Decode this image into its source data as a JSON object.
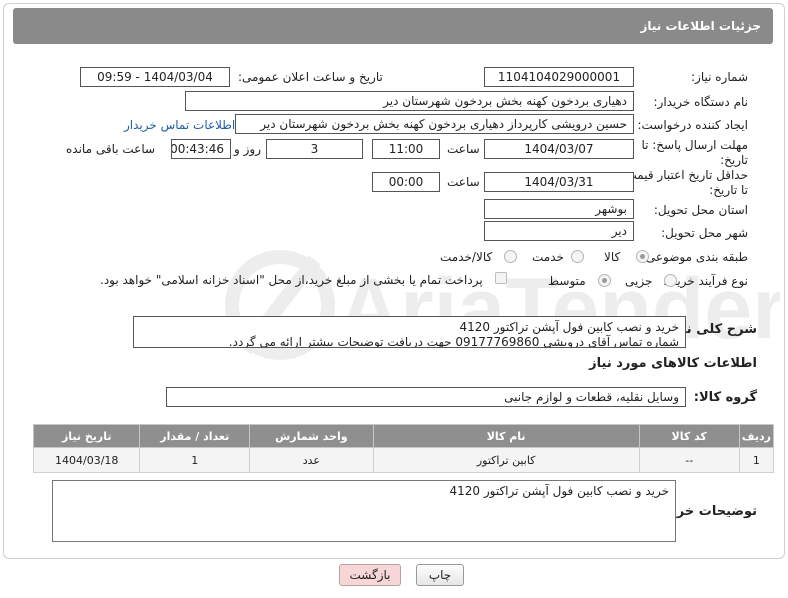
{
  "page_title": "جزئیات اطلاعات نیاز",
  "fields": {
    "need_number_label": "شماره نیاز:",
    "need_number": "1104104029000001",
    "announce_label": "تاریخ و ساعت اعلان عمومی:",
    "announce_value": "1404/03/04 - 09:59",
    "buyer_org_label": "نام دستگاه خریدار:",
    "buyer_org": "دهیاری بردخون کهنه بخش بردخون شهرستان دیر",
    "creator_label": "ایجاد کننده درخواست:",
    "creator": "حسین درویشی کارپرداز دهیاری بردخون کهنه بخش بردخون شهرستان دیر",
    "contact_link": "اطلاعات تماس خریدار",
    "deadline_label_1": "مهلت ارسال پاسخ: تا",
    "deadline_label_2": "تاریخ:",
    "deadline_date": "1404/03/07",
    "time_label": "ساعت",
    "deadline_time": "11:00",
    "days_value": "3",
    "days_label": "روز و",
    "remaining_time": "00:43:46",
    "remaining_label": "ساعت باقی مانده",
    "min_validity_label_1": "حداقل تاریخ اعتبار قیمت:",
    "min_validity_label_2": "تا تاریخ:",
    "validity_date": "1404/03/31",
    "validity_time": "00:00",
    "province_label": "استان محل تحویل:",
    "province": "بوشهر",
    "city_label": "شهر محل تحویل:",
    "city": "دیر",
    "category_label": "طبقه بندی موضوعی:",
    "category_options": [
      "کالا",
      "خدمت",
      "کالا/خدمت"
    ],
    "process_label": "نوع فرآیند خرید :",
    "process_options": [
      "جزیی",
      "متوسط"
    ],
    "payment_note": "پرداخت تمام یا بخشی از مبلغ خرید،از محل \"اسناد خزانه اسلامی\" خواهد بود."
  },
  "description": {
    "label": "شرح کلی نیاز:",
    "line1": "خرید و نصب کابین فول آپشن تراکتور 4120",
    "line2": "شماره تماس  آقای درویشی 09177769860 جهت دریافت توضیحات بیشتر ارائه می گردد."
  },
  "goods_section_title": "اطلاعات کالاهای مورد نیاز",
  "goods_group_label": "گروه کالا:",
  "goods_group": "وسایل نقلیه، قطعات و لوازم جانبی",
  "table": {
    "headers": [
      "ردیف",
      "کد کالا",
      "نام کالا",
      "واحد شمارش",
      "تعداد / مقدار",
      "تاریخ نیاز"
    ],
    "rows": [
      [
        "1",
        "--",
        "کابین تراکتور",
        "عدد",
        "1",
        "1404/03/18"
      ]
    ]
  },
  "buyer_notes_label": "توضیحات خریدار:",
  "buyer_notes": "خرید و نصب کابین فول آپشن تراکتور 4120",
  "buttons": {
    "print": "چاپ",
    "back": "بازگشت"
  },
  "watermark_text": "AriaTender.neT"
}
